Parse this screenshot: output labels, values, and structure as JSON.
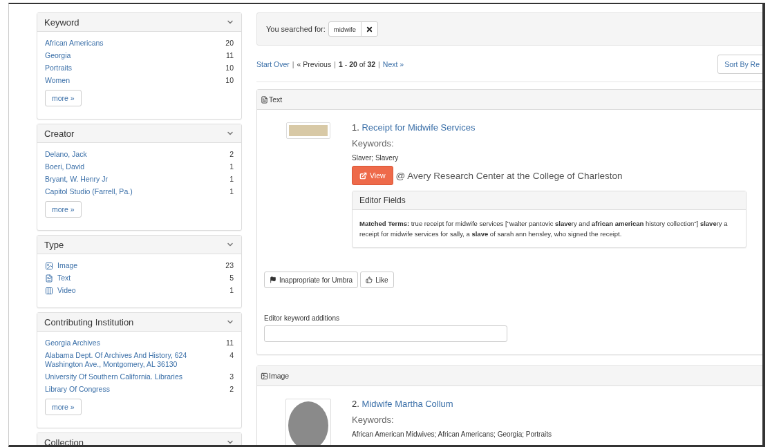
{
  "facets": [
    {
      "title": "Keyword",
      "expanded": true,
      "items": [
        {
          "label": "African Americans",
          "count": "20"
        },
        {
          "label": "Georgia",
          "count": "11"
        },
        {
          "label": "Portraits",
          "count": "10"
        },
        {
          "label": "Women",
          "count": "10"
        }
      ],
      "more": "more »"
    },
    {
      "title": "Creator",
      "expanded": true,
      "items": [
        {
          "label": "Delano, Jack",
          "count": "2"
        },
        {
          "label": "Boeri, David",
          "count": "1"
        },
        {
          "label": "Bryant, W. Henry Jr",
          "count": "1"
        },
        {
          "label": "Capitol Studio (Farrell, Pa.)",
          "count": "1"
        }
      ],
      "more": "more »"
    },
    {
      "title": "Type",
      "expanded": true,
      "items": [
        {
          "label": "Image",
          "count": "23",
          "kind": "image"
        },
        {
          "label": "Text",
          "count": "5",
          "kind": "text"
        },
        {
          "label": "Video",
          "count": "1",
          "kind": "video"
        }
      ]
    },
    {
      "title": "Contributing Institution",
      "expanded": true,
      "items": [
        {
          "label": "Georgia Archives",
          "count": "11"
        },
        {
          "label": "Alabama Dept. Of Archives And History, 624 Washington Ave., Montgomery, AL 36130",
          "count": "4"
        },
        {
          "label": "University Of Southern California. Libraries",
          "count": "3"
        },
        {
          "label": "Library Of Congress",
          "count": "2"
        }
      ],
      "more": "more »"
    },
    {
      "title": "Collection",
      "expanded": true
    }
  ],
  "search": {
    "label": "You searched for:",
    "term": "midwife"
  },
  "pager": [
    {
      "kind": "link",
      "text": "Start Over"
    },
    {
      "kind": "sep",
      "text": "|"
    },
    {
      "kind": "plain",
      "text": "« Previous"
    },
    {
      "kind": "sep",
      "text": "|"
    },
    {
      "kind": "plain",
      "text": "**1** - **20** of **32**"
    },
    {
      "kind": "sep",
      "text": "|"
    },
    {
      "kind": "link",
      "text": "Next »"
    }
  ],
  "sort_button": "Sort By Re",
  "results": [
    {
      "kind": "text",
      "type_label": "Text",
      "number": "1.",
      "title": "Receipt for Midwife Services",
      "keywords_label": "Keywords:",
      "keywords": "Slaver; Slavery",
      "view_button": "View",
      "institution": "@ Avery Research Center at the College of Charleston",
      "editor_fields": {
        "title": "Editor Fields",
        "text": "**Matched Terms:** true receipt for midwife services [\"walter pantovic **slave**ry and **african american** history collection\"] **slave**ry a receipt for midwife services for sally, a **slave** of sarah ann hensley, who signed the receipt."
      },
      "actions": [
        {
          "kind": "flag",
          "label": "Inappropriate for Umbra"
        },
        {
          "kind": "like",
          "label": "Like"
        }
      ],
      "keyword_field": {
        "label": "Editor keyword additions"
      }
    },
    {
      "kind": "image",
      "type_label": "Image",
      "number": "2.",
      "title": "Midwife Martha Collum",
      "keywords_label": "Keywords:",
      "keywords": "African American Midwives; African Americans; Georgia; Portraits"
    }
  ]
}
